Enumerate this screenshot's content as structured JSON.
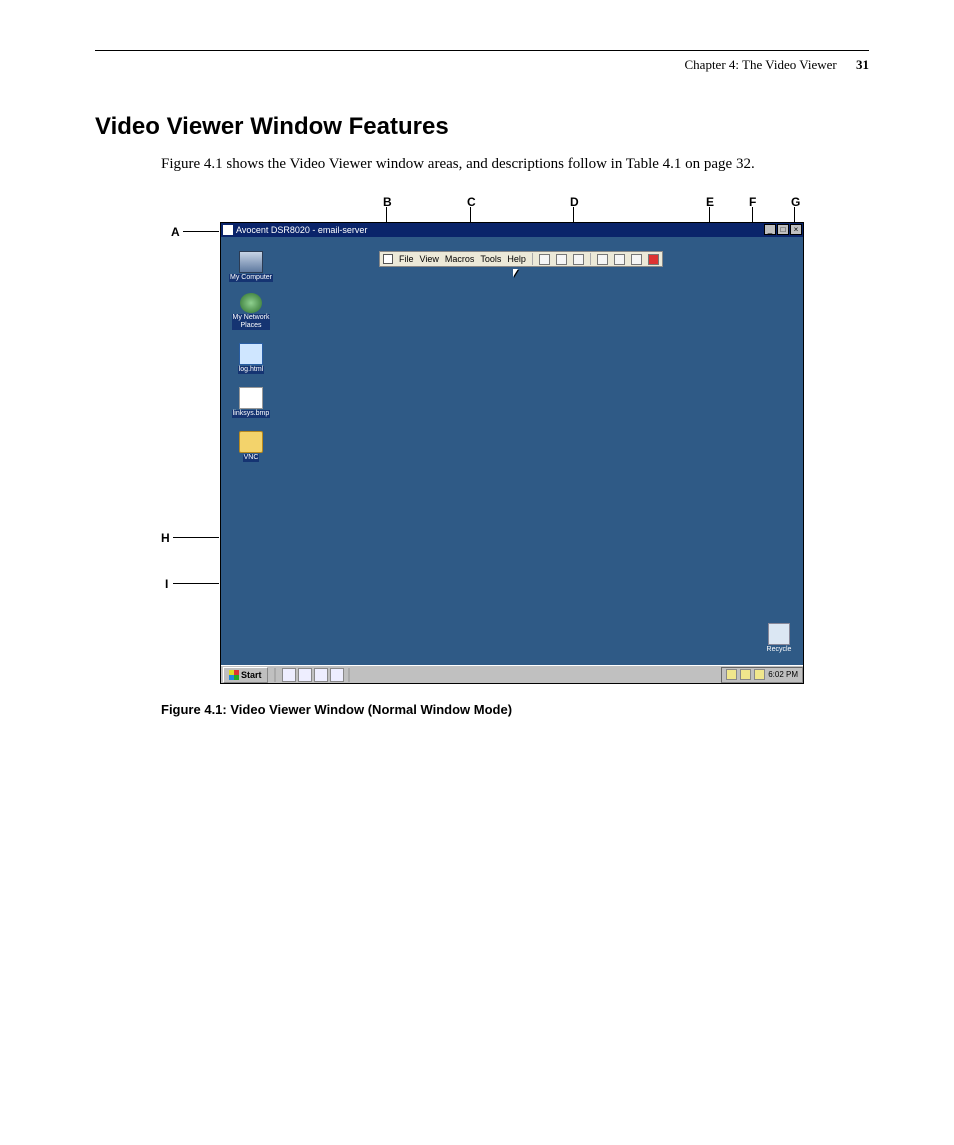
{
  "header": {
    "chapter": "Chapter 4: The Video Viewer",
    "page_number": "31"
  },
  "heading": "Video Viewer Window Features",
  "intro": "Figure 4.1 shows the Video Viewer window areas, and descriptions follow in Table 4.1 on page 32.",
  "callouts": {
    "A": "A",
    "B": "B",
    "C": "C",
    "D": "D",
    "E": "E",
    "F": "F",
    "G": "G",
    "H": "H",
    "I": "I"
  },
  "window": {
    "title": "Avocent DSR8020 - email-server",
    "min": "_",
    "max": "□",
    "close": "×"
  },
  "menu": {
    "file": "File",
    "view": "View",
    "macros": "Macros",
    "tools": "Tools",
    "help": "Help"
  },
  "desktop_icons": {
    "my_computer": "My Computer",
    "my_network_places": "My Network\nPlaces",
    "log_html": "log.html",
    "linksys_bmp": "linksys.bmp",
    "vnc": "VNC",
    "recycle": "Recycle"
  },
  "taskbar": {
    "start": "Start",
    "clock": "6:02 PM"
  },
  "caption": "Figure 4.1: Video Viewer Window (Normal Window Mode)"
}
